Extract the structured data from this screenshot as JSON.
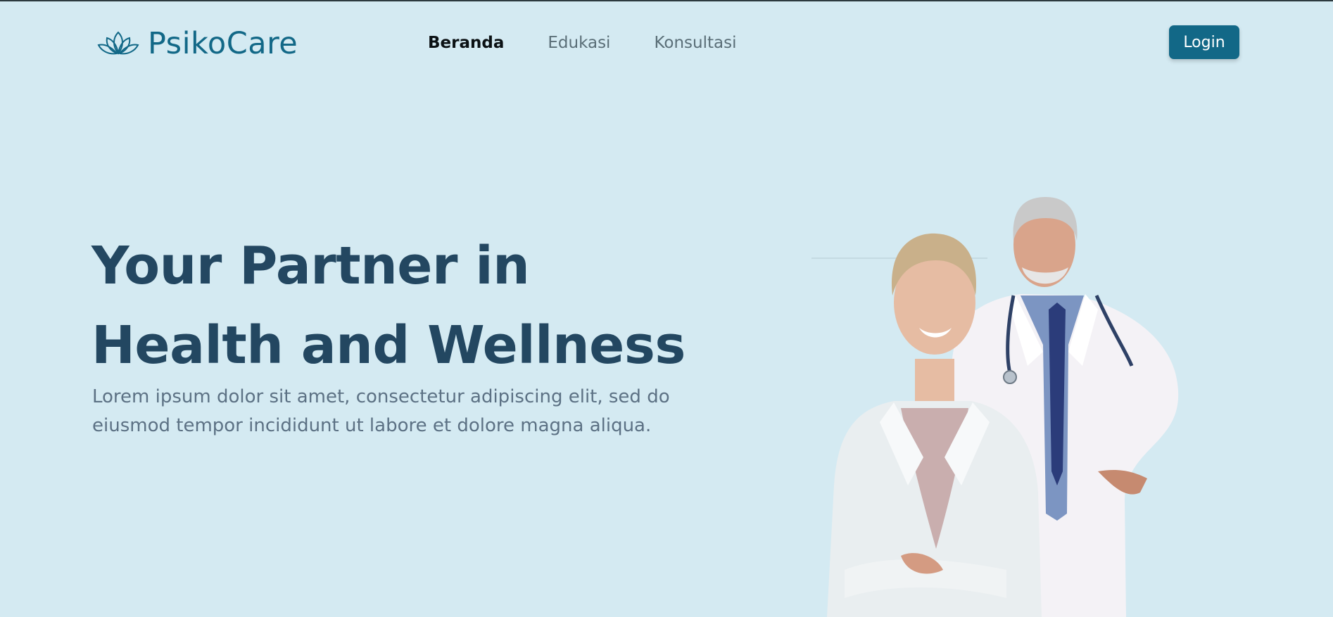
{
  "brand": {
    "name": "PsikoCare",
    "logo_icon": "lotus-icon",
    "color": "#126887"
  },
  "nav": {
    "items": [
      {
        "label": "Beranda",
        "active": true
      },
      {
        "label": "Edukasi",
        "active": false
      },
      {
        "label": "Konsultasi",
        "active": false
      }
    ]
  },
  "header": {
    "login_label": "Login"
  },
  "hero": {
    "title_line1": "Your Partner in",
    "title_line2": "Health and Wellness",
    "description": "Lorem ipsum dolor sit amet, consectetur adipiscing elit, sed do eiusmod tempor incididunt ut labore et dolore magna aliqua.",
    "image_subject": "two-doctors-illustration"
  },
  "colors": {
    "background": "#d4eaf2",
    "title": "#234761",
    "body_text": "#5c7184",
    "button": "#126887"
  }
}
